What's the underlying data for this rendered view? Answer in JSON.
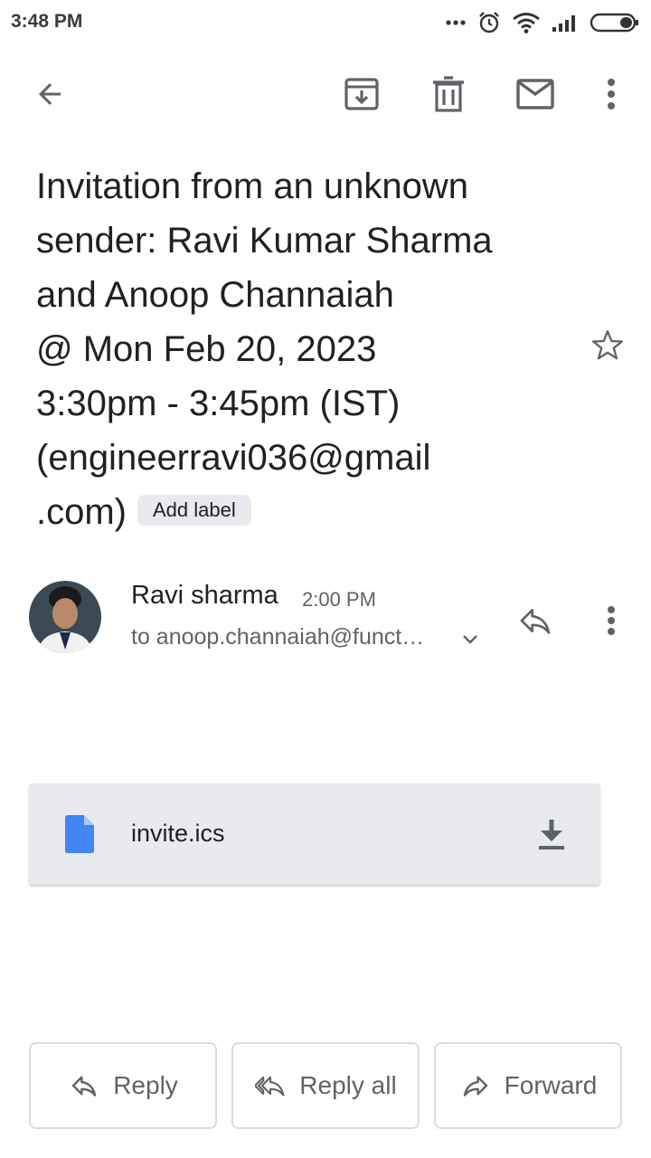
{
  "status_bar": {
    "time": "3:48 PM",
    "icons": [
      "more-dots-icon",
      "alarm-icon",
      "wifi-icon",
      "signal-icon",
      "battery-icon"
    ]
  },
  "toolbar": {
    "icons": [
      "back-arrow-icon",
      "archive-icon",
      "delete-icon",
      "mark-unread-icon",
      "more-vert-icon"
    ]
  },
  "subject": {
    "lines": [
      "Invitation from an unknown",
      "sender: Ravi Kumar Sharma",
      "and Anoop Channaiah",
      "@ Mon Feb 20, 2023",
      "3:30pm - 3:45pm (IST)",
      "(engineerravi036@gmail",
      ".com)"
    ],
    "label_chip": "Add label"
  },
  "message": {
    "sender_name": "Ravi sharma",
    "time": "2:00 PM",
    "recipients": "to anoop.channaiah@funct…"
  },
  "attachment": {
    "file_name": "invite.ics"
  },
  "actions": {
    "reply": "Reply",
    "reply_all": "Reply all",
    "forward": "Forward"
  },
  "colors": {
    "accent_blue": "#4285f4",
    "icon_grey": "#5f6368",
    "chip_bg": "#e8eaed"
  }
}
